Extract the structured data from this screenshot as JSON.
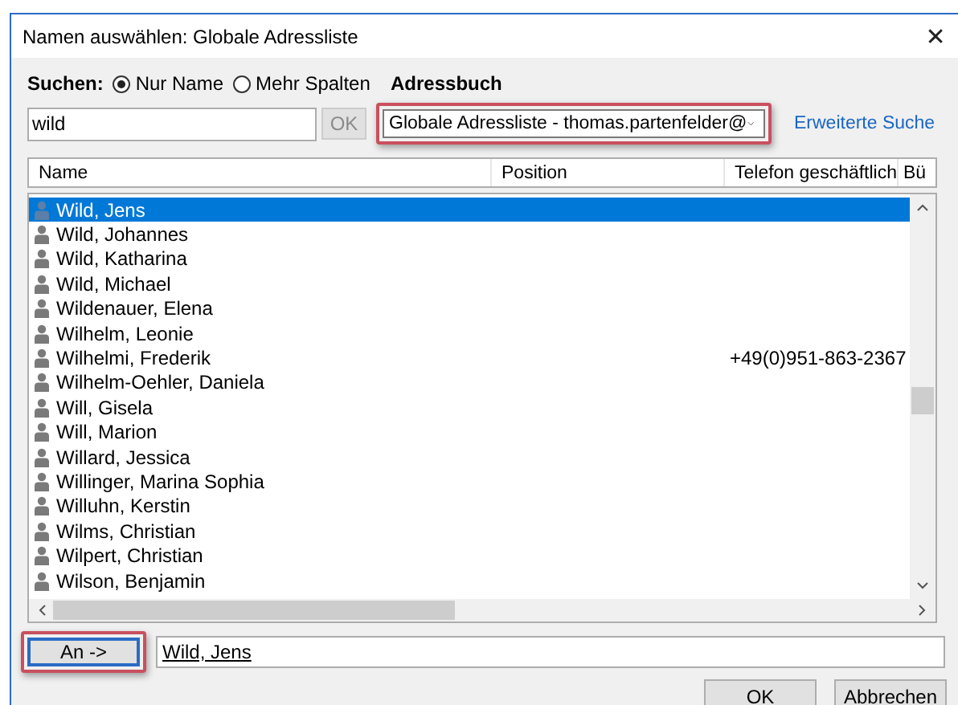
{
  "window": {
    "title": "Namen auswählen: Globale Adressliste",
    "close": "✕"
  },
  "search": {
    "label": "Suchen:",
    "modes": [
      {
        "label": "Nur Name",
        "selected": true
      },
      {
        "label": "Mehr Spalten",
        "selected": false
      }
    ],
    "value": "wild",
    "ok": "OK"
  },
  "addressbook": {
    "label": "Adressbuch",
    "value": "Globale Adressliste - thomas.partenfelder@",
    "highlighted": true
  },
  "advanced_link": "Erweiterte Suche",
  "table": {
    "columns": [
      "Name",
      "Position",
      "Telefon geschäftlich",
      "Bü"
    ],
    "rows": [
      {
        "name": "Wild, Jens",
        "selected": true
      },
      {
        "name": "Wild, Johannes",
        "selected": false
      },
      {
        "name": "Wild, Katharina",
        "selected": false
      },
      {
        "name": "Wild, Michael",
        "selected": false
      },
      {
        "name": "Wildenauer, Elena",
        "selected": false
      },
      {
        "name": "Wilhelm, Leonie",
        "selected": false
      },
      {
        "name": "Wilhelmi, Frederik",
        "selected": false,
        "phone": "+49(0)951-863-2367"
      },
      {
        "name": "Wilhelm-Oehler, Daniela",
        "selected": false
      },
      {
        "name": "Will, Gisela",
        "selected": false
      },
      {
        "name": "Will, Marion",
        "selected": false
      },
      {
        "name": "Willard, Jessica",
        "selected": false
      },
      {
        "name": "Willinger, Marina Sophia",
        "selected": false
      },
      {
        "name": "Willuhn, Kerstin",
        "selected": false
      },
      {
        "name": "Wilms, Christian",
        "selected": false
      },
      {
        "name": "Wilpert, Christian",
        "selected": false
      },
      {
        "name": "Wilson, Benjamin",
        "selected": false
      }
    ]
  },
  "to": {
    "button": "An ->",
    "highlighted": true,
    "value": "Wild, Jens"
  },
  "buttons": [
    "OK",
    "Abbrechen"
  ]
}
